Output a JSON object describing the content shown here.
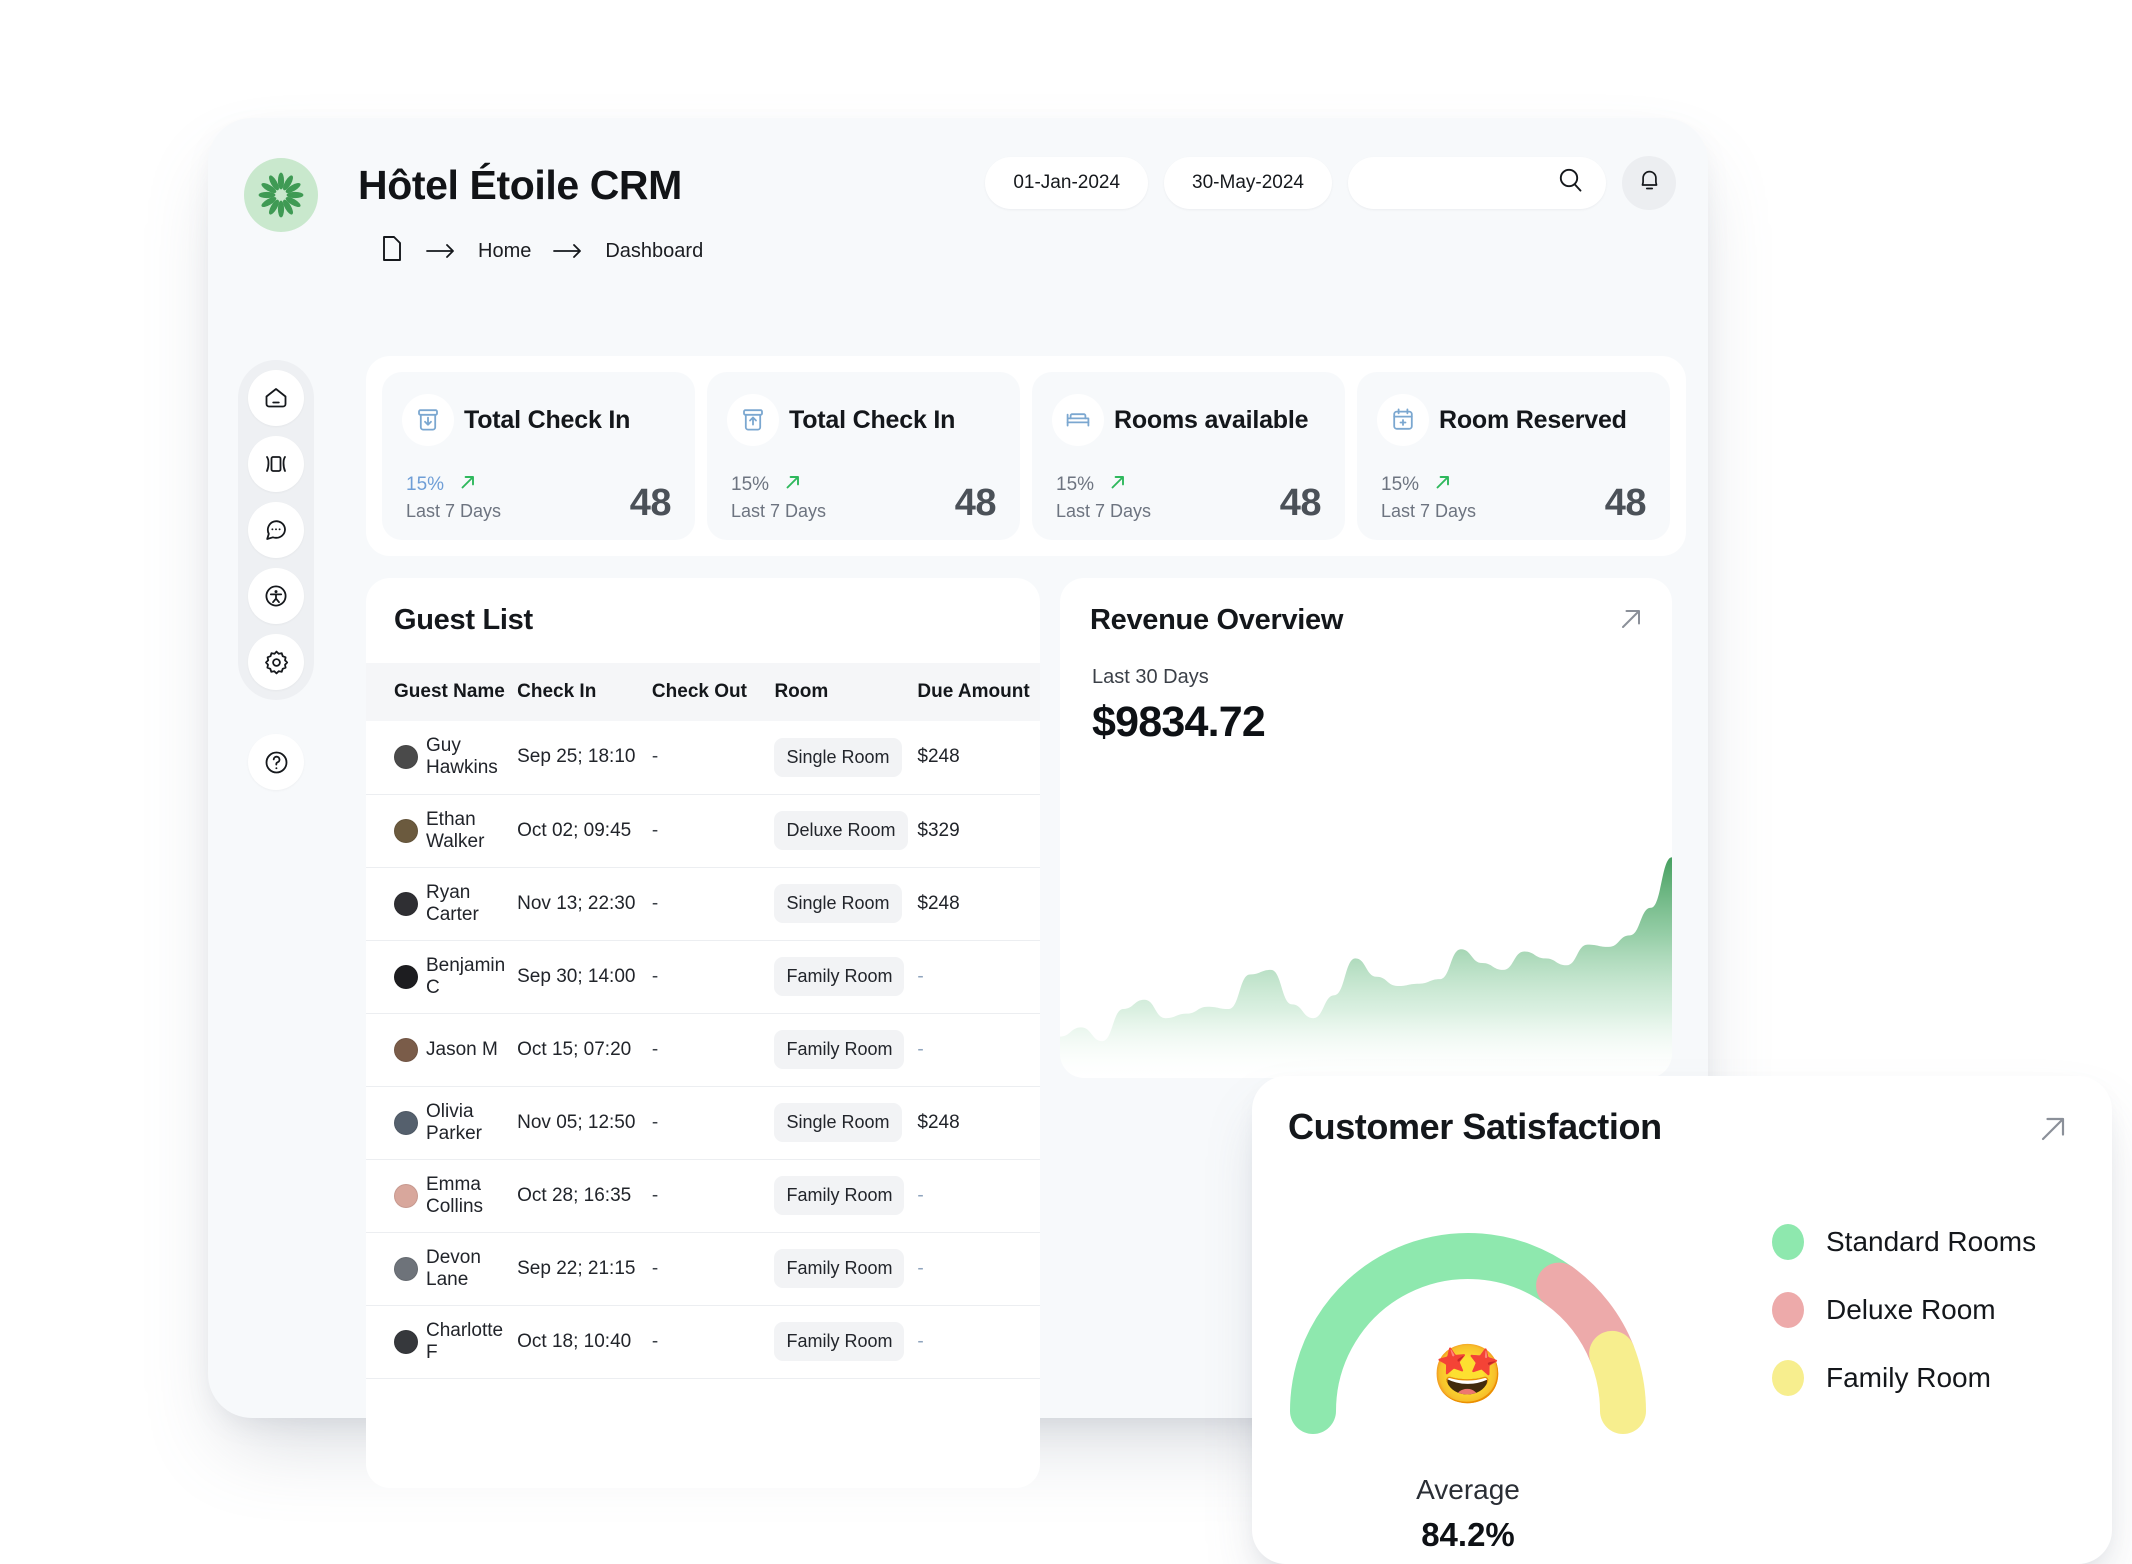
{
  "app": {
    "title": "Hôtel Étoile CRM",
    "logo_icon": "flower-logo-icon",
    "accent_green": "#3f9a54",
    "logo_bg": "#c9e8cd"
  },
  "breadcrumb": {
    "file_icon": "file-icon",
    "arrow_icon": "arrow-right-icon",
    "items": [
      "Home",
      "Dashboard"
    ]
  },
  "header": {
    "date_from": "01-Jan-2024",
    "date_to": "30-May-2024",
    "search_placeholder": "",
    "search_value": "",
    "search_icon": "search-icon",
    "notification_icon": "bell-icon"
  },
  "sidebar": {
    "items": [
      {
        "name": "home",
        "icon": "home-icon"
      },
      {
        "name": "layout",
        "icon": "columns-layout-icon"
      },
      {
        "name": "messages",
        "icon": "chat-bubble-icon"
      },
      {
        "name": "accessibility",
        "icon": "person-accessibility-icon"
      },
      {
        "name": "settings",
        "icon": "gear-icon"
      }
    ],
    "help": {
      "name": "help",
      "icon": "question-circle-icon"
    }
  },
  "kpis": [
    {
      "title": "Total Check In",
      "icon": "box-arrow-down-icon",
      "percent": "15%",
      "percent_style": "accent",
      "period": "Last 7 Days",
      "value": "48",
      "trend_icon": "trend-up-icon"
    },
    {
      "title": "Total Check In",
      "icon": "box-arrow-up-icon",
      "percent": "15%",
      "percent_style": "muted",
      "period": "Last 7 Days",
      "value": "48",
      "trend_icon": "trend-up-icon"
    },
    {
      "title": "Rooms available",
      "icon": "bed-icon",
      "percent": "15%",
      "percent_style": "muted",
      "period": "Last 7 Days",
      "value": "48",
      "trend_icon": "trend-up-icon"
    },
    {
      "title": "Room Reserved",
      "icon": "calendar-plus-icon",
      "percent": "15%",
      "percent_style": "muted",
      "period": "Last 7 Days",
      "value": "48",
      "trend_icon": "trend-up-icon"
    }
  ],
  "guest_list": {
    "title": "Guest List",
    "columns": [
      "Guest Name",
      "Check In",
      "Check Out",
      "Room",
      "Due Amount"
    ],
    "rows": [
      {
        "name": "Guy Hawkins",
        "check_in": "Sep 25; 18:10",
        "check_out": "-",
        "room": "Single Room",
        "due": "$248",
        "avatar_color": "#4a4a4a"
      },
      {
        "name": "Ethan Walker",
        "check_in": "Oct 02; 09:45",
        "check_out": "-",
        "room": "Deluxe Room",
        "due": "$329",
        "avatar_color": "#6b5a3e"
      },
      {
        "name": "Ryan Carter",
        "check_in": "Nov 13; 22:30",
        "check_out": "-",
        "room": "Single Room",
        "due": "$248",
        "avatar_color": "#2f2f33"
      },
      {
        "name": "Benjamin C",
        "check_in": "Sep 30; 14:00",
        "check_out": "-",
        "room": "Family Room",
        "due": "-",
        "avatar_color": "#1d1d20"
      },
      {
        "name": "Jason M",
        "check_in": "Oct 15; 07:20",
        "check_out": "-",
        "room": "Family Room",
        "due": "-",
        "avatar_color": "#7a5c49"
      },
      {
        "name": "Olivia Parker",
        "check_in": "Nov 05; 12:50",
        "check_out": "-",
        "room": "Single Room",
        "due": "$248",
        "avatar_color": "#55606d"
      },
      {
        "name": "Emma Collins",
        "check_in": "Oct 28; 16:35",
        "check_out": "-",
        "room": "Family Room",
        "due": "-",
        "avatar_color": "#d8a79c"
      },
      {
        "name": "Devon Lane",
        "check_in": "Sep 22; 21:15",
        "check_out": "-",
        "room": "Family Room",
        "due": "-",
        "avatar_color": "#6e737a"
      },
      {
        "name": "Charlotte F",
        "check_in": "Oct 18; 10:40",
        "check_out": "-",
        "room": "Family Room",
        "due": "-",
        "avatar_color": "#36383c"
      }
    ]
  },
  "revenue": {
    "title": "Revenue Overview",
    "expand_icon": "arrow-up-right-icon",
    "period": "Last 30 Days",
    "amount": "$9834.72"
  },
  "satisfaction": {
    "title": "Customer Satisfaction",
    "expand_icon": "arrow-up-right-icon",
    "emoji": "🤩",
    "average_label": "Average",
    "average_value": "84.2%",
    "legend": [
      {
        "label": "Standard Rooms",
        "color": "#8EE8AE"
      },
      {
        "label": "Deluxe Room",
        "color": "#EDAAAA"
      },
      {
        "label": "Family Room",
        "color": "#F7EE8E"
      }
    ]
  },
  "chart_data": [
    {
      "type": "area",
      "title": "Revenue Overview",
      "subtitle": "Last 30 Days",
      "total": 9834.72,
      "xlabel": "",
      "ylabel": "",
      "grid": false,
      "legend": "none",
      "x": [
        1,
        2,
        3,
        4,
        5,
        6,
        7,
        8,
        9,
        10,
        11,
        12,
        13,
        14,
        15,
        16,
        17,
        18,
        19,
        20,
        21,
        22,
        23,
        24,
        25,
        26,
        27,
        28,
        29,
        30
      ],
      "values": [
        18,
        22,
        16,
        30,
        34,
        26,
        28,
        31,
        30,
        45,
        47,
        32,
        26,
        36,
        52,
        44,
        40,
        41,
        43,
        56,
        50,
        47,
        55,
        52,
        49,
        58,
        57,
        62,
        74,
        96
      ],
      "ylim": [
        0,
        100
      ],
      "fill_top_color": "#3c9a57",
      "fill_bottom_color": "#ffffff"
    },
    {
      "type": "pie",
      "subtype": "gauge",
      "title": "Customer Satisfaction",
      "labels": [
        "Standard Rooms",
        "Deluxe Room",
        "Family Room"
      ],
      "values": [
        70,
        18,
        12
      ],
      "colors": [
        "#8EE8AE",
        "#EDAAAA",
        "#F7EE8E"
      ],
      "center_label": "Average",
      "center_value": 84.2,
      "units": "%",
      "legend": "right"
    }
  ]
}
